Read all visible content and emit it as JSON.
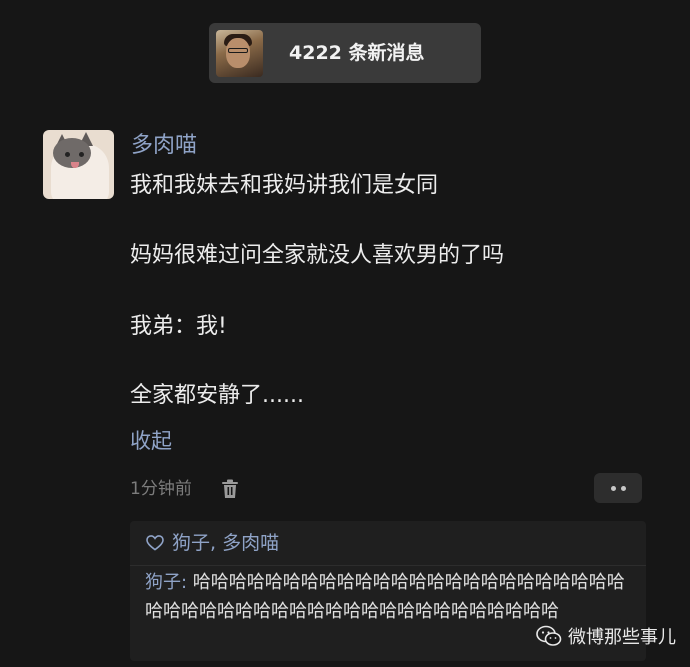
{
  "banner": {
    "new_messages": "4222 条新消息"
  },
  "comment": {
    "username": "多肉喵",
    "lines": [
      "我和我妹去和我妈讲我们是女同",
      "妈妈很难过问全家就没人喜欢男的了吗",
      "我弟：我!",
      "全家都安静了......"
    ],
    "collapse_label": "收起",
    "time": "1分钟前",
    "icons": {
      "delete": "trash-icon",
      "more": "more-dots-icon",
      "like": "heart-icon"
    }
  },
  "likes": {
    "names": "狗子, 多肉喵"
  },
  "reply": {
    "author": "狗子:",
    "text": " 哈哈哈哈哈哈哈哈哈哈哈哈哈哈哈哈哈哈哈哈哈哈哈哈哈哈哈哈哈哈哈哈哈哈哈哈哈哈哈哈哈哈哈哈哈哈哈"
  },
  "watermark": {
    "text": "微博那些事儿"
  },
  "colors": {
    "background": "#161616",
    "link_blue": "#8fa3c7",
    "text": "#ececec",
    "muted": "#7c7c7c"
  }
}
